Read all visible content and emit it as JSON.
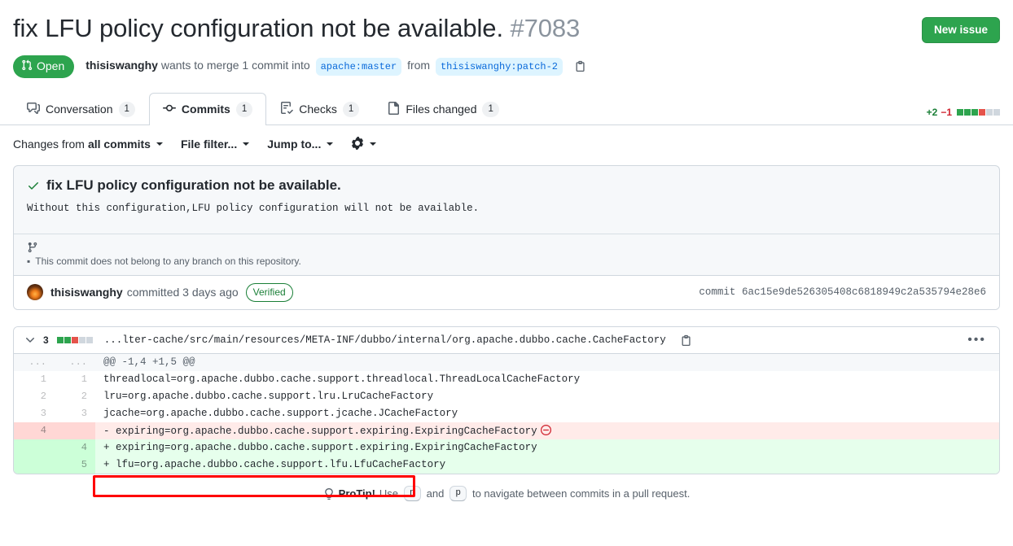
{
  "header": {
    "title": "fix LFU policy configuration not be available.",
    "number": "#7083",
    "new_issue_label": "New issue",
    "state": "Open",
    "author": "thisiswanghy",
    "merge_text_1": "wants to merge 1 commit into",
    "base_branch": "apache:master",
    "from_label": "from",
    "head_branch": "thisiswanghy:patch-2",
    "copy_icon": "copy-icon"
  },
  "tabs": [
    {
      "label": "Conversation",
      "count": "1",
      "icon": "comment-discussion-icon",
      "selected": false
    },
    {
      "label": "Commits",
      "count": "1",
      "icon": "git-commit-icon",
      "selected": true
    },
    {
      "label": "Checks",
      "count": "1",
      "icon": "checklist-icon",
      "selected": false
    },
    {
      "label": "Files changed",
      "count": "1",
      "icon": "file-diff-icon",
      "selected": false
    }
  ],
  "diffstat_top": {
    "additions": "+2",
    "deletions": "−1",
    "blocks": [
      "add",
      "add",
      "add",
      "del",
      "neutral",
      "neutral"
    ]
  },
  "subbar": {
    "changes_from_prefix": "Changes from",
    "changes_from_value": "all commits",
    "file_filter": "File filter...",
    "jump_to": "Jump to...",
    "gear_icon": "gear-icon"
  },
  "commit": {
    "title": "fix LFU policy configuration not be available.",
    "description": "Without this configuration,LFU policy configuration will not be available.",
    "branch_note": "This commit does not belong to any branch on this repository.",
    "author": "thisiswanghy",
    "committed_text": "committed 3 days ago",
    "verified": "Verified",
    "sha_label": "commit",
    "sha": "6ac15e9de526305408c6818949c2a535794e28e6"
  },
  "file": {
    "change_count": "3",
    "blocks": [
      "add",
      "add",
      "del",
      "neutral",
      "neutral"
    ],
    "path": "...lter-cache/src/main/resources/META-INF/dubbo/internal/org.apache.dubbo.cache.CacheFactory",
    "copy_icon": "copy-icon",
    "menu_icon": "kebab-menu-icon",
    "diff_rows": [
      {
        "type": "hunk",
        "old": "...",
        "new": "...",
        "code": "@@ -1,4 +1,5 @@"
      },
      {
        "type": "ctx",
        "old": "1",
        "new": "1",
        "code": "threadlocal=org.apache.dubbo.cache.support.threadlocal.ThreadLocalCacheFactory"
      },
      {
        "type": "ctx",
        "old": "2",
        "new": "2",
        "code": "lru=org.apache.dubbo.cache.support.lru.LruCacheFactory"
      },
      {
        "type": "ctx",
        "old": "3",
        "new": "3",
        "code": "jcache=org.apache.dubbo.cache.support.jcache.JCacheFactory"
      },
      {
        "type": "del",
        "old": "4",
        "new": "",
        "code": "- expiring=org.apache.dubbo.cache.support.expiring.ExpiringCacheFactory",
        "whitespace_marker": true
      },
      {
        "type": "add",
        "old": "",
        "new": "4",
        "code": "+ expiring=org.apache.dubbo.cache.support.expiring.ExpiringCacheFactory"
      },
      {
        "type": "add",
        "old": "",
        "new": "5",
        "code": "+ lfu=org.apache.dubbo.cache.support.lfu.LfuCacheFactory"
      }
    ]
  },
  "protip": {
    "icon": "lightbulb-icon",
    "label": "ProTip!",
    "text_1": "Use",
    "key_1": "n",
    "text_2": "and",
    "key_2": "p",
    "text_3": "to navigate between commits in a pull request."
  },
  "colors": {
    "green": "#2da44e",
    "red": "#cf222e",
    "blue": "#0969da",
    "annotation": "#ff0000"
  }
}
